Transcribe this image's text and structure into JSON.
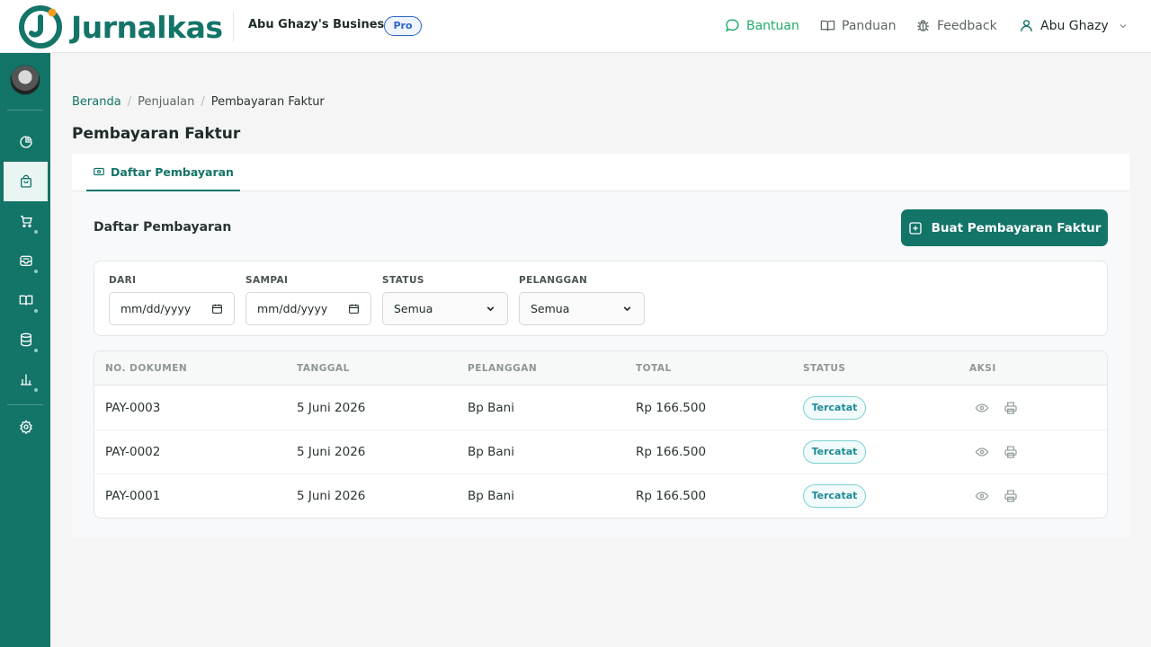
{
  "brand": {
    "name": "Jurnalkas"
  },
  "header": {
    "business_name": "Abu Ghazy's Business",
    "plan_badge": "Pro",
    "nav": {
      "help": "Bantuan",
      "guide": "Panduan",
      "feedback": "Feedback",
      "user": "Abu Ghazy"
    }
  },
  "sidebar": {
    "items": [
      {
        "icon": "pie-chart-icon"
      },
      {
        "icon": "shopping-bag-icon",
        "active": true
      },
      {
        "icon": "cart-icon"
      },
      {
        "icon": "inbox-icon"
      },
      {
        "icon": "book-icon"
      },
      {
        "icon": "database-icon"
      },
      {
        "icon": "bar-chart-icon"
      },
      {
        "icon": "gear-icon"
      }
    ]
  },
  "breadcrumb": {
    "home": "Beranda",
    "section": "Penjualan",
    "current": "Pembayaran Faktur"
  },
  "page": {
    "title": "Pembayaran Faktur",
    "tab_label": "Daftar Pembayaran",
    "section_title": "Daftar Pembayaran",
    "create_button": "Buat Pembayaran Faktur"
  },
  "filters": {
    "from": {
      "label": "DARI",
      "value": "mm/dd/yyyy"
    },
    "to": {
      "label": "SAMPAI",
      "value": "mm/dd/yyyy"
    },
    "status": {
      "label": "STATUS",
      "value": "Semua"
    },
    "customer": {
      "label": "PELANGGAN",
      "value": "Semua"
    }
  },
  "table": {
    "columns": [
      "NO. DOKUMEN",
      "TANGGAL",
      "PELANGGAN",
      "TOTAL",
      "STATUS",
      "AKSI"
    ],
    "rows": [
      {
        "doc": "PAY-0003",
        "date": "5 Juni 2026",
        "customer": "Bp Bani",
        "total": "Rp 166.500",
        "status": "Tercatat"
      },
      {
        "doc": "PAY-0002",
        "date": "5 Juni 2026",
        "customer": "Bp Bani",
        "total": "Rp 166.500",
        "status": "Tercatat"
      },
      {
        "doc": "PAY-0001",
        "date": "5 Juni 2026",
        "customer": "Bp Bani",
        "total": "Rp 166.500",
        "status": "Tercatat"
      }
    ]
  },
  "colors": {
    "brand": "#137468",
    "accent_orange": "#f39c1f",
    "help_green": "#1fad6a",
    "pro_blue": "#2c64c9",
    "status_teal": "#1d8a96"
  }
}
